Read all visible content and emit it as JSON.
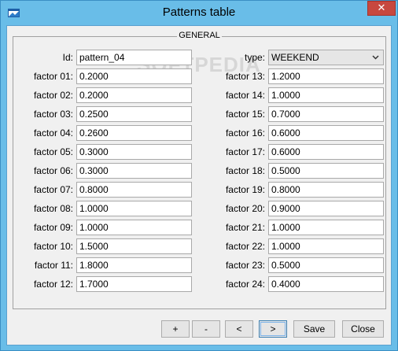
{
  "window": {
    "title": "Patterns table",
    "close_symbol": "✕",
    "icon": "app-window-icon"
  },
  "group": {
    "title": "GENERAL",
    "watermark": "SOFTPEDIA"
  },
  "id_field": {
    "label": "Id:",
    "value": "pattern_04"
  },
  "type_field": {
    "label": "type:",
    "value": "WEEKEND"
  },
  "left_factors": [
    {
      "label": "factor 01:",
      "value": "0.2000"
    },
    {
      "label": "factor 02:",
      "value": "0.2000"
    },
    {
      "label": "factor 03:",
      "value": "0.2500"
    },
    {
      "label": "factor 04:",
      "value": "0.2600"
    },
    {
      "label": "factor 05:",
      "value": "0.3000"
    },
    {
      "label": "factor 06:",
      "value": "0.3000"
    },
    {
      "label": "factor 07:",
      "value": "0.8000"
    },
    {
      "label": "factor 08:",
      "value": "1.0000"
    },
    {
      "label": "factor 09:",
      "value": "1.0000"
    },
    {
      "label": "factor 10:",
      "value": "1.5000"
    },
    {
      "label": "factor 11:",
      "value": "1.8000"
    },
    {
      "label": "factor 12:",
      "value": "1.7000"
    }
  ],
  "right_factors": [
    {
      "label": "factor 13:",
      "value": "1.2000"
    },
    {
      "label": "factor 14:",
      "value": "1.0000"
    },
    {
      "label": "factor 15:",
      "value": "0.7000"
    },
    {
      "label": "factor 16:",
      "value": "0.6000"
    },
    {
      "label": "factor 17:",
      "value": "0.6000"
    },
    {
      "label": "factor 18:",
      "value": "0.5000"
    },
    {
      "label": "factor 19:",
      "value": "0.8000"
    },
    {
      "label": "factor 20:",
      "value": "0.9000"
    },
    {
      "label": "factor 21:",
      "value": "1.0000"
    },
    {
      "label": "factor 22:",
      "value": "1.0000"
    },
    {
      "label": "factor 23:",
      "value": "0.5000"
    },
    {
      "label": "factor 24:",
      "value": "0.4000"
    }
  ],
  "buttons": {
    "add": "+",
    "remove": "-",
    "prev": "<",
    "next": ">",
    "save": "Save",
    "close": "Close"
  },
  "colors": {
    "window_frame": "#69bde8",
    "close_button": "#c7483f",
    "client_bg": "#f0f0f0"
  }
}
